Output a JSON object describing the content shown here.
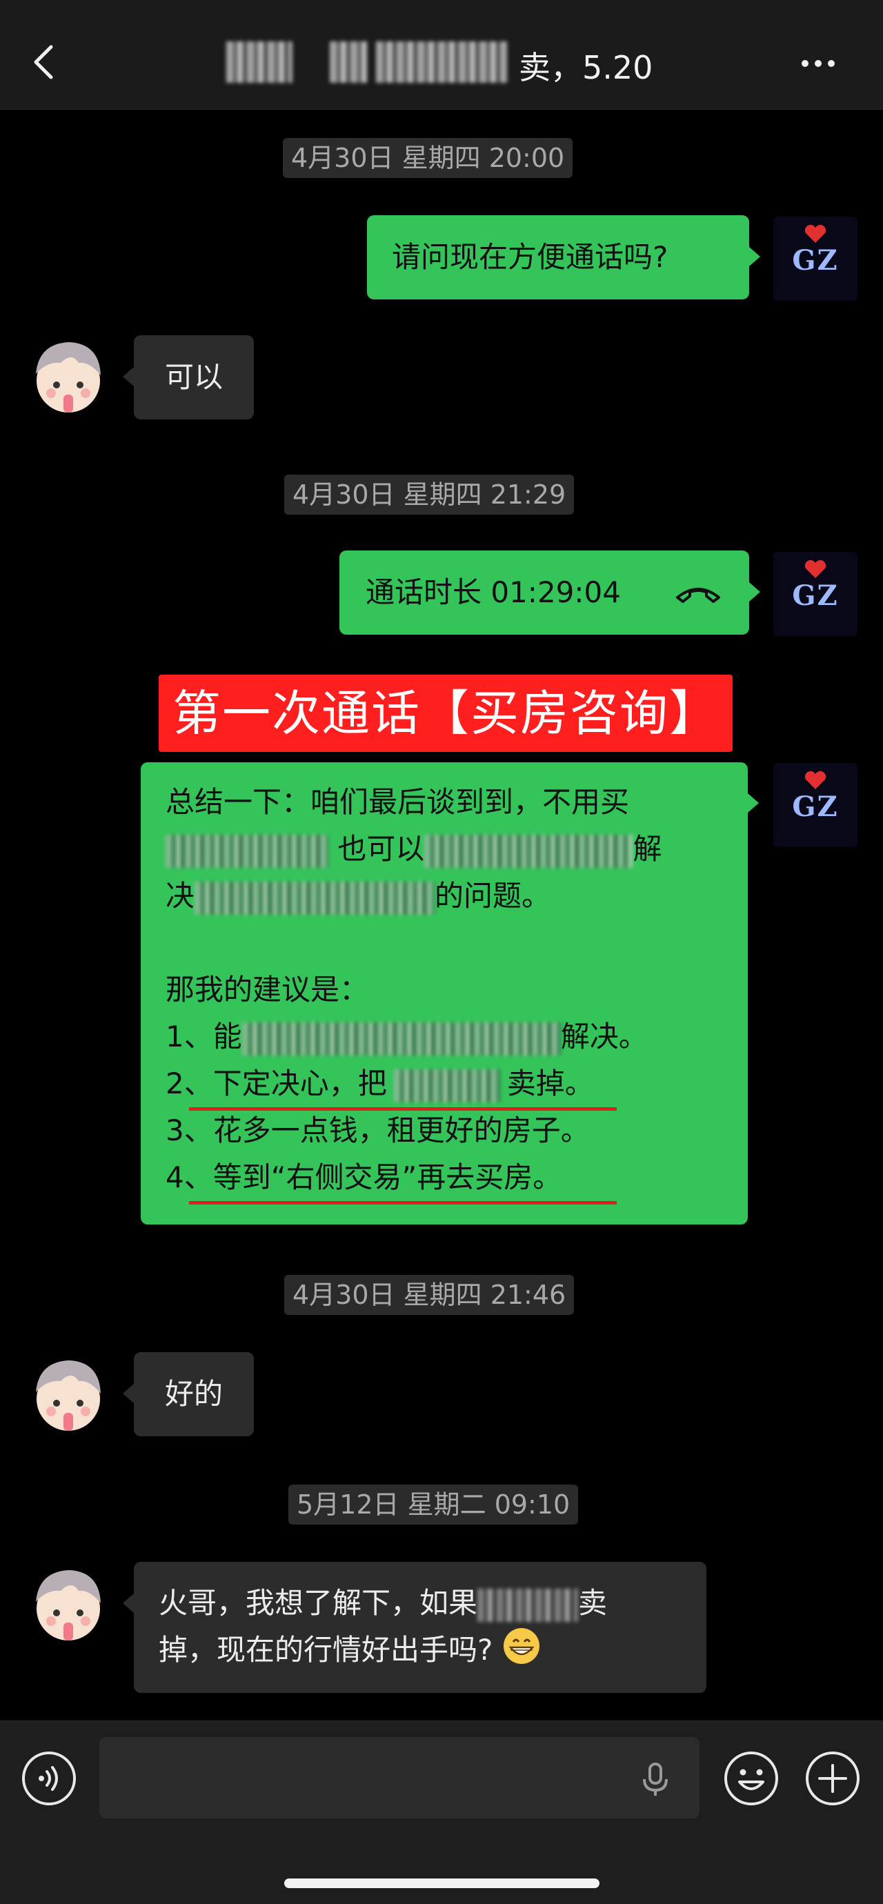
{
  "header": {
    "title_suffix": "卖，5.20"
  },
  "timestamps": {
    "t1": "4月30日 星期四 20:00",
    "t2": "4月30日 星期四 21:29",
    "t3": "4月30日 星期四 21:46",
    "t4": "5月12日 星期二 09:10"
  },
  "messages": {
    "m1": "请问现在方便通话吗?",
    "m2": "可以",
    "call_duration": "通话时长 01:29:04",
    "m3": "好的",
    "m4_line1_a": "火哥，我想了解下，如果",
    "m4_line1_b": "卖",
    "m4_line2": "掉，现在的行情好出手吗?"
  },
  "banner": {
    "text": "第一次通话【买房咨询】"
  },
  "summary": {
    "l1": "总结一下：咱们最后谈到到，不用买",
    "l2_a": "也可以",
    "l2_b": "解",
    "l3_a": "决",
    "l3_b": "的问题。",
    "l4": "那我的建议是：",
    "l5_a": "1、能",
    "l5_b": "解决。",
    "l6_a": "2、下定决心，把",
    "l6_b": "卖掉。",
    "l7": "3、花多一点钱，租更好的房子。",
    "l8": "4、等到“右侧交易”再去买房。"
  },
  "avatar_me_text": "GZ",
  "colors": {
    "bubble_me": "#34c45a",
    "bubble_other": "#2c2c2c",
    "banner": "#ff1f1f",
    "underline": "#e01e1e"
  },
  "icons": [
    "back-icon",
    "more-icon",
    "call-icon",
    "voice-icon",
    "mic-icon",
    "emoji-icon",
    "plus-icon",
    "grin-emoji-icon"
  ]
}
